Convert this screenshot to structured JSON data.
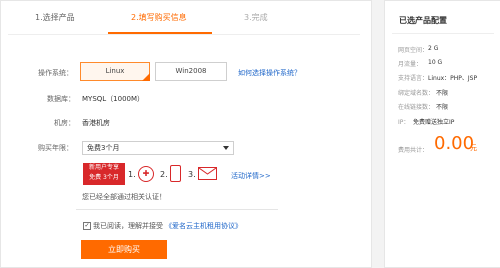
{
  "steps": [
    {
      "label": "1.选择产品"
    },
    {
      "label": "2.填写购买信息"
    },
    {
      "label": "3.完成"
    }
  ],
  "form": {
    "os_label": "操作系统：",
    "os_options": [
      "Linux",
      "Win2008"
    ],
    "os_help": "如何选择操作系统？",
    "db_label": "数据库：",
    "db_value": "MYSQL（1000M）",
    "room_label": "机房：",
    "room_value": "香港机房",
    "term_label": "购买年限：",
    "term_value": "免费3个月"
  },
  "promo": {
    "badge_line1": "新用户专享",
    "badge_line2": "免费 3个月",
    "step1": "1.",
    "step2": "2.",
    "step3": "3.",
    "details_link": "活动详情>>",
    "auth_text": "您已经全部通过相关认证！"
  },
  "agreement": {
    "prefix": "我已阅读，理解并接受",
    "link": "《爱名云主机租用协议》"
  },
  "buy_button": "立即购买",
  "config": {
    "title": "已选产品配置",
    "rows": [
      {
        "label": "网页空间：",
        "value": "2 G"
      },
      {
        "label": "月流量：",
        "value": "10 G"
      },
      {
        "label": "支持语言：",
        "value": "Linux：PHP、JSP"
      },
      {
        "label": "绑定域名数：",
        "value": "不限"
      },
      {
        "label": "在线链接数：",
        "value": "不限"
      },
      {
        "label": "IP：",
        "value": "免费赠送独立IP"
      }
    ],
    "cost_label": "费用共计：",
    "cost_value": "0.00",
    "cost_unit": "元"
  },
  "colors": {
    "accent": "#ff6a00",
    "link": "#1e66c9",
    "promo": "#d8282a"
  },
  "icons": {
    "dropdown": "triangle-down-icon",
    "check": "checkbox-checked-icon"
  }
}
